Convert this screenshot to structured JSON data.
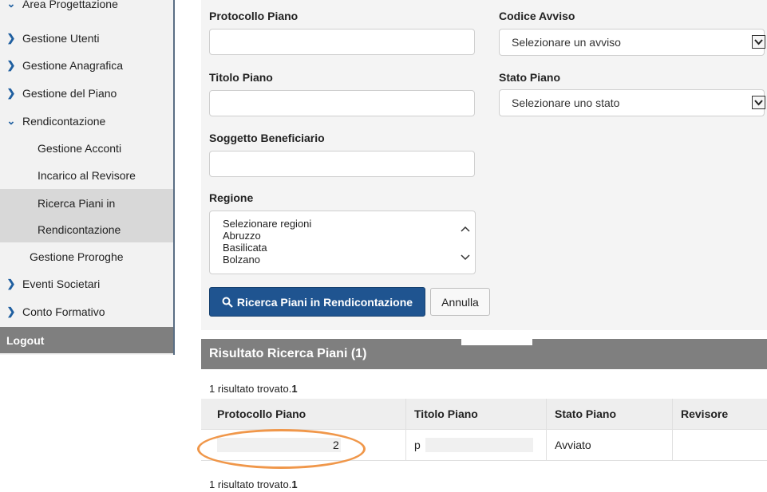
{
  "sidebar": {
    "items": [
      {
        "label": "Area Progettazione",
        "type": "parent"
      },
      {
        "label": "Gestione Utenti",
        "type": "parent"
      },
      {
        "label": "Gestione Anagrafica",
        "type": "parent"
      },
      {
        "label": "Gestione del Piano",
        "type": "parent"
      },
      {
        "label": "Rendicontazione",
        "type": "parent-open"
      },
      {
        "label": "Gestione Acconti",
        "type": "sub"
      },
      {
        "label": "Incarico al Revisore",
        "type": "sub"
      },
      {
        "label": "Ricerca Piani in",
        "type": "sub-active"
      },
      {
        "label": "Rendicontazione",
        "type": "sub-active"
      },
      {
        "label": "Gestione Proroghe",
        "type": "sub"
      },
      {
        "label": "Eventi Societari",
        "type": "parent"
      },
      {
        "label": "Conto Formativo",
        "type": "parent"
      }
    ],
    "logout": "Logout"
  },
  "form": {
    "protocollo_label": "Protocollo Piano",
    "titolo_label": "Titolo Piano",
    "soggetto_label": "Soggetto Beneficiario",
    "regione_label": "Regione",
    "codice_label": "Codice Avviso",
    "codice_value": "Selezionare un avviso",
    "stato_label": "Stato Piano",
    "stato_value": "Selezionare uno stato",
    "regioni": [
      "Selezionare regioni",
      "Abruzzo",
      "Basilicata",
      "Bolzano"
    ],
    "search_button": "Ricerca Piani in Rendicontazione",
    "cancel_button": "Annulla"
  },
  "results": {
    "title": "Risultato Ricerca Piani  (1)",
    "count_text": "1 risultato trovato.",
    "count_value": "1",
    "columns": [
      "Protocollo Piano",
      "Titolo Piano",
      "Stato Piano",
      "Revisore"
    ],
    "rows": [
      {
        "protocollo": "2",
        "titolo": "p",
        "stato": "Avviato",
        "revisore": ""
      }
    ]
  },
  "colors": {
    "primary_button": "#1f5490",
    "header_gray": "#7f7f7f",
    "highlight_circle": "#f0974a"
  }
}
